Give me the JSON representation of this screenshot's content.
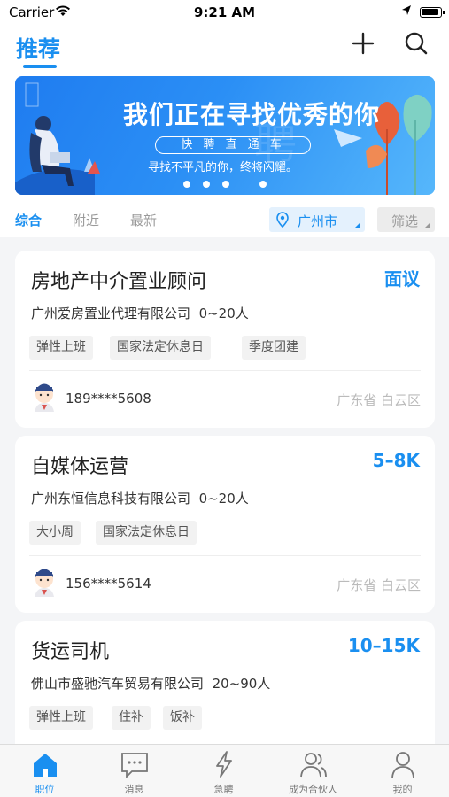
{
  "status_bar": {
    "carrier": "Carrier",
    "time": "9:21 AM"
  },
  "header": {
    "title": "推荐",
    "accent_color": "#1a8ff0"
  },
  "banner": {
    "headline": "我们正在寻找优秀的你",
    "subtitle": "快 聘 直 通 车",
    "tagline": "寻找不平凡的你，终将闪耀。",
    "carousel_pages": 4,
    "active_page": 1
  },
  "filters": {
    "tabs": [
      "综合",
      "附近",
      "最新"
    ],
    "active_tab": "综合",
    "city": "广州市",
    "filter_label": "筛选"
  },
  "jobs": [
    {
      "title": "房地产中介置业顾问",
      "salary": "面议",
      "company": "广州爱房置业代理有限公司",
      "headcount": "0~20人",
      "tags": [
        "弹性上班",
        "国家法定休息日",
        "季度团建"
      ],
      "phone": "189****5608",
      "location": "广东省 白云区"
    },
    {
      "title": "自媒体运营",
      "salary": "5–8K",
      "company": "广州东恒信息科技有限公司",
      "headcount": "0~20人",
      "tags": [
        "大小周",
        "国家法定休息日"
      ],
      "phone": "156****5614",
      "location": "广东省 白云区"
    },
    {
      "title": "货运司机",
      "salary": "10–15K",
      "company": "佛山市盛驰汽车贸易有限公司",
      "headcount": "20~90人",
      "tags": [
        "弹性上班",
        "住补",
        "饭补"
      ],
      "phone": "",
      "location": ""
    }
  ],
  "tab_bar": {
    "items": [
      {
        "label": "职位",
        "icon": "home-icon",
        "active": true
      },
      {
        "label": "消息",
        "icon": "message-icon",
        "active": false
      },
      {
        "label": "急聘",
        "icon": "lightning-icon",
        "active": false
      },
      {
        "label": "成为合伙人",
        "icon": "partner-icon",
        "active": false
      },
      {
        "label": "我的",
        "icon": "profile-icon",
        "active": false
      }
    ]
  }
}
